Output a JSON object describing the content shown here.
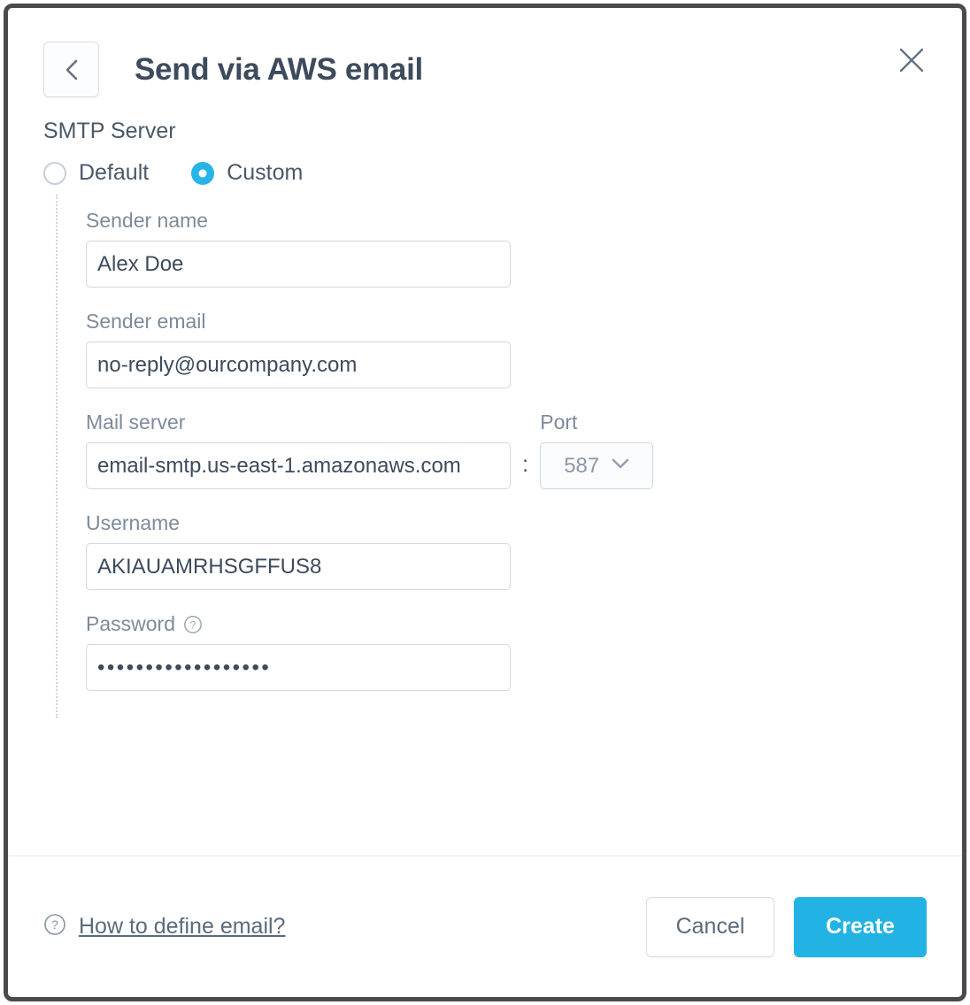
{
  "header": {
    "title": "Send via AWS email",
    "back_icon": "chevron-left-icon",
    "close_icon": "close-icon"
  },
  "smtp": {
    "section_label": "SMTP Server",
    "options": [
      {
        "label": "Default",
        "selected": false
      },
      {
        "label": "Custom",
        "selected": true
      }
    ]
  },
  "fields": {
    "sender_name": {
      "label": "Sender name",
      "value": "Alex Doe",
      "placeholder": "Sender name"
    },
    "sender_email": {
      "label": "Sender email",
      "value": "no-reply@ourcompany.com",
      "placeholder": "Sender email"
    },
    "mail_server": {
      "label": "Mail server",
      "value": "email-smtp.us-east-1.amazonaws.com",
      "placeholder": "Mail server"
    },
    "separator": ":",
    "port": {
      "label": "Port",
      "value": "587",
      "chevron_icon": "chevron-down-icon"
    },
    "username": {
      "label": "Username",
      "value": "AKIAUAMRHSGFFUS8",
      "placeholder": "Username"
    },
    "password": {
      "label": "Password",
      "help_icon": "question-circle-icon",
      "masked_value": "••••••••••••••••••",
      "placeholder": "Password"
    }
  },
  "footer": {
    "help_icon": "question-circle-icon",
    "help_link": "How to define email?",
    "cancel_label": "Cancel",
    "create_label": "Create"
  },
  "colors": {
    "accent": "#22b3e4",
    "radio_selected": "#29b4e8",
    "title_text": "#3d4b5c",
    "label_text": "#7d8b9a",
    "border": "#cdd8e3",
    "frame": "#4a4a4a"
  }
}
